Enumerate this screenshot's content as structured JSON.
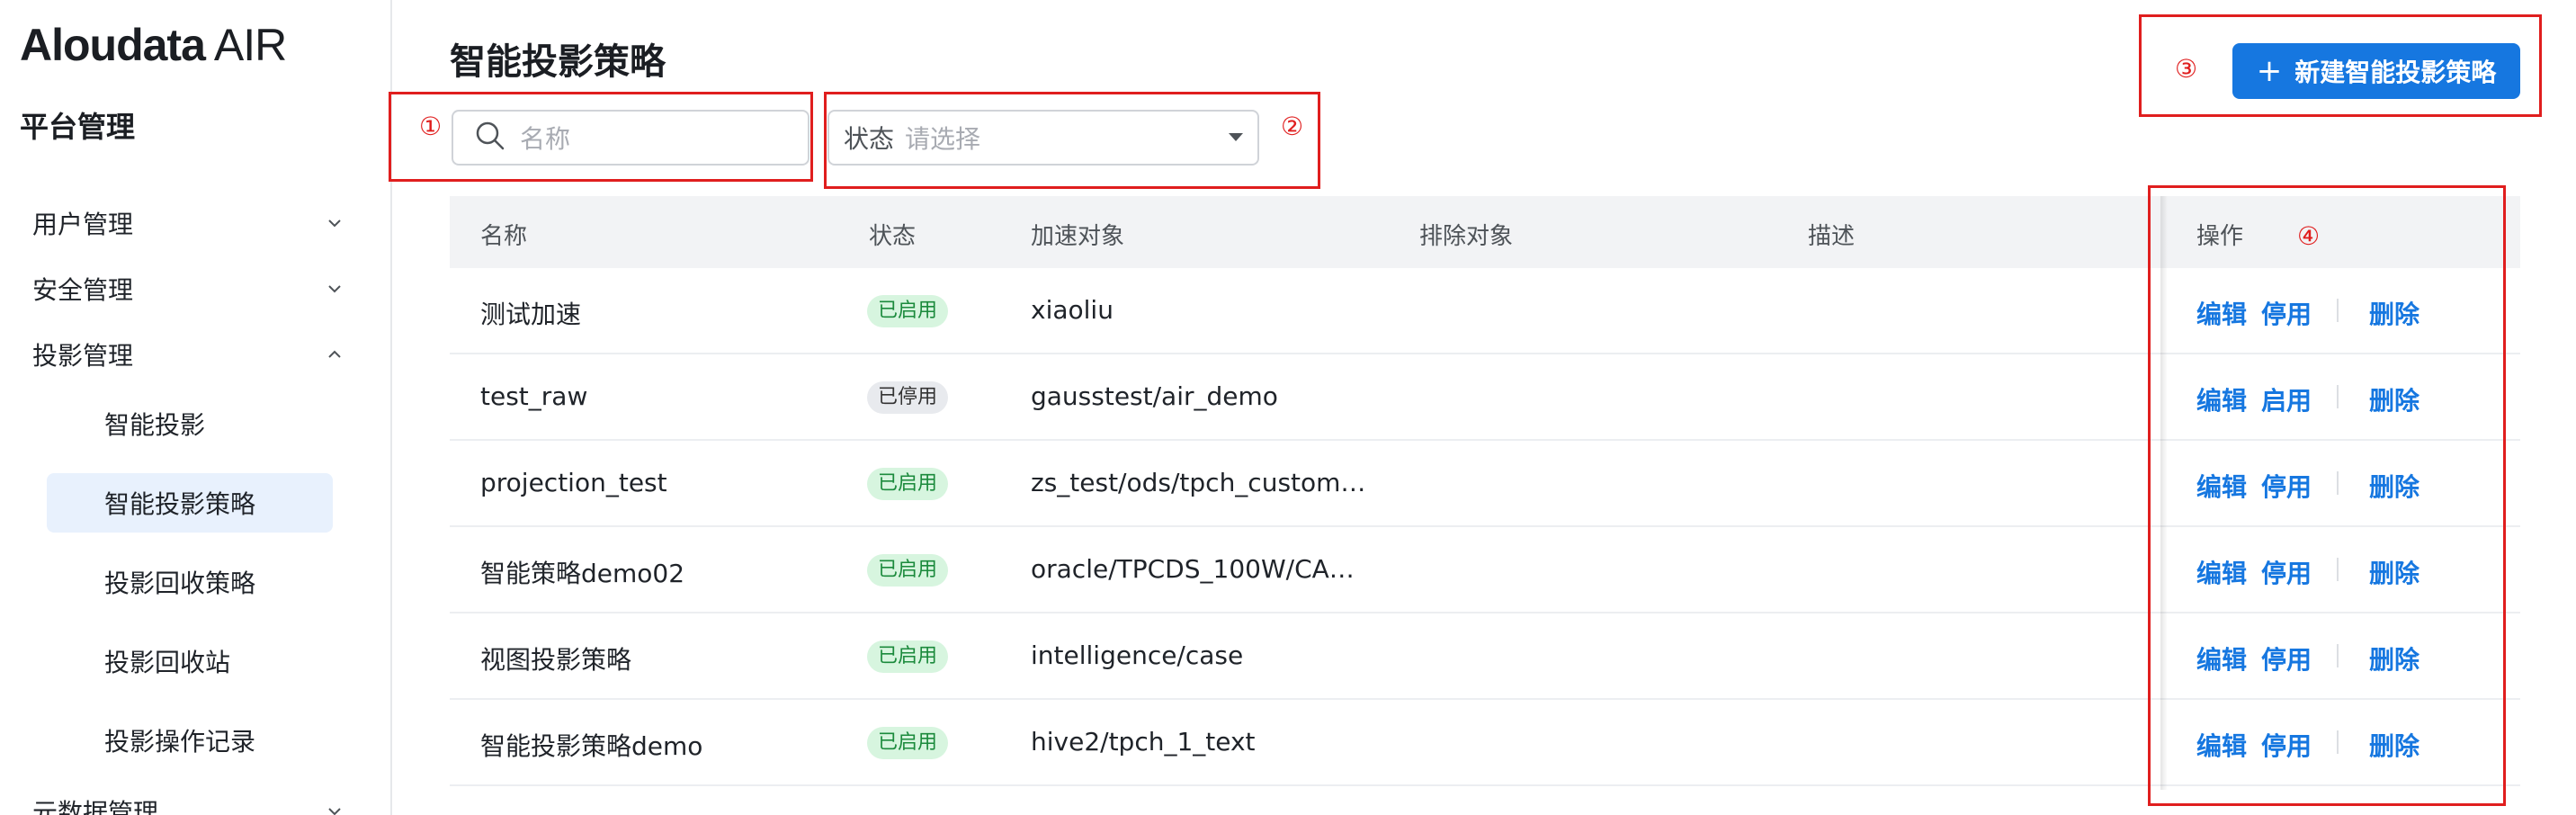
{
  "brand": {
    "name": "Aloudata",
    "product": "AIR"
  },
  "sidebar": {
    "title": "平台管理",
    "menu": [
      {
        "label": "用户管理",
        "expanded": false
      },
      {
        "label": "安全管理",
        "expanded": false
      },
      {
        "label": "投影管理",
        "expanded": true
      },
      {
        "label": "元数据管理",
        "expanded": false
      }
    ],
    "submenu": [
      {
        "label": "智能投影",
        "active": false
      },
      {
        "label": "智能投影策略",
        "active": true
      },
      {
        "label": "投影回收策略",
        "active": false
      },
      {
        "label": "投影回收站",
        "active": false
      },
      {
        "label": "投影操作记录",
        "active": false
      }
    ]
  },
  "page": {
    "title": "智能投影策略",
    "create_button": "新建智能投影策略",
    "search": {
      "placeholder": "名称"
    },
    "status_filter": {
      "label": "状态",
      "placeholder": "请选择"
    }
  },
  "annotations": [
    "①",
    "②",
    "③",
    "④"
  ],
  "table": {
    "columns": [
      "名称",
      "状态",
      "加速对象",
      "排除对象",
      "描述",
      "操作"
    ],
    "rows": [
      {
        "name": "测试加速",
        "status": "已启用",
        "enabled": true,
        "target": "xiaoliu",
        "exclude": "",
        "desc": "",
        "actions": [
          "编辑",
          "停用",
          "删除"
        ]
      },
      {
        "name": "test_raw",
        "status": "已停用",
        "enabled": false,
        "target": "gausstest/air_demo",
        "exclude": "",
        "desc": "",
        "actions": [
          "编辑",
          "启用",
          "删除"
        ]
      },
      {
        "name": "projection_test",
        "status": "已启用",
        "enabled": true,
        "target": "zs_test/ods/tpch_custom…",
        "exclude": "",
        "desc": "",
        "actions": [
          "编辑",
          "停用",
          "删除"
        ]
      },
      {
        "name": "智能策略demo02",
        "status": "已启用",
        "enabled": true,
        "target": "oracle/TPCDS_100W/CA…",
        "exclude": "",
        "desc": "",
        "actions": [
          "编辑",
          "停用",
          "删除"
        ]
      },
      {
        "name": "视图投影策略",
        "status": "已启用",
        "enabled": true,
        "target": "intelligence/case",
        "exclude": "",
        "desc": "",
        "actions": [
          "编辑",
          "停用",
          "删除"
        ]
      },
      {
        "name": "智能投影策略demo",
        "status": "已启用",
        "enabled": true,
        "target": "hive2/tpch_1_text",
        "exclude": "",
        "desc": "",
        "actions": [
          "编辑",
          "停用",
          "删除"
        ]
      }
    ]
  },
  "colors": {
    "primary": "#1677e0",
    "annotation": "#e01e1e",
    "enabled_bg": "#d7f5df",
    "enabled_fg": "#1b8a3c",
    "active_menu_bg": "#e8f1fd"
  }
}
